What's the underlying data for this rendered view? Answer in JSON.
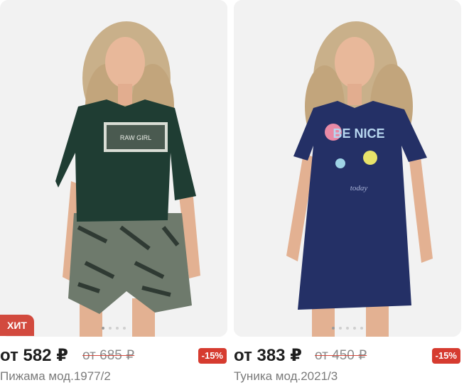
{
  "products": [
    {
      "badge": "ХИТ",
      "price": "от 582 ₽",
      "old_price": "от 685 ₽",
      "discount": "-15%",
      "title": "Пижама мод.1977/2",
      "print_text": "RAW GIRL"
    },
    {
      "price": "от 383 ₽",
      "old_price": "от 450 ₽",
      "discount": "-15%",
      "title": "Туника мод.2021/3",
      "print_text": "BE NICE",
      "print_subtext": "today"
    }
  ],
  "colors": {
    "badge_bg": "#d24a3e",
    "discount_bg": "#d63b2f",
    "shirt_green": "#1f3d33",
    "dress_navy": "#243066"
  }
}
